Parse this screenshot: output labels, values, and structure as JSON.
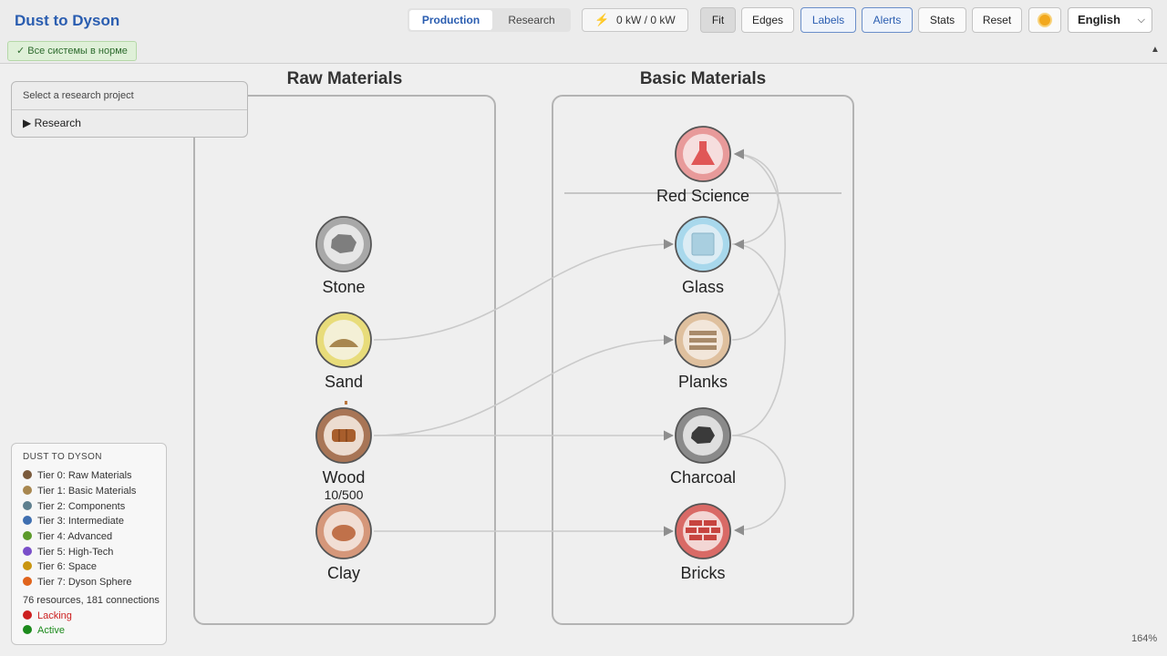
{
  "app": {
    "title": "Dust to Dyson",
    "status": "✓ Все системы в норме"
  },
  "tabs": [
    {
      "label": "Production",
      "active": true
    },
    {
      "label": "Research",
      "active": false
    }
  ],
  "power": {
    "icon": "lightning-icon",
    "value": "0 kW / 0 kW"
  },
  "toolbar": {
    "fit": "Fit",
    "edges": "Edges",
    "labels": "Labels",
    "alerts": "Alerts",
    "stats": "Stats",
    "reset": "Reset",
    "theme_icon": "sun-icon",
    "language": "English"
  },
  "groups": {
    "raw": {
      "title": "Raw Materials"
    },
    "basic": {
      "title": "Basic Materials"
    }
  },
  "nodes": {
    "stone": {
      "label": "Stone",
      "color": "#a8a8a8"
    },
    "sand": {
      "label": "Sand",
      "color": "#e8dc7a"
    },
    "wood": {
      "label": "Wood",
      "stock": "10/500",
      "color": "#a87556"
    },
    "clay": {
      "label": "Clay",
      "color": "#d5977a"
    },
    "red_science": {
      "label": "Red Science",
      "color": "#e89a9a"
    },
    "glass": {
      "label": "Glass",
      "color": "#a8d8ec"
    },
    "planks": {
      "label": "Planks",
      "color": "#dfc09e"
    },
    "charcoal": {
      "label": "Charcoal",
      "color": "#8a8a8a"
    },
    "bricks": {
      "label": "Bricks",
      "color": "#d96a66"
    }
  },
  "research_panel": {
    "placeholder": "Select a research project",
    "toggle": "▶ Research"
  },
  "legend": {
    "title": "DUST TO DYSON",
    "tiers": [
      {
        "label": "Tier 0: Raw Materials",
        "color": "#7a5a3c"
      },
      {
        "label": "Tier 1: Basic Materials",
        "color": "#a8874f"
      },
      {
        "label": "Tier 2: Components",
        "color": "#5e7f8e"
      },
      {
        "label": "Tier 3: Intermediate",
        "color": "#3f6fb0"
      },
      {
        "label": "Tier 4: Advanced",
        "color": "#5c9a2a"
      },
      {
        "label": "Tier 5: High-Tech",
        "color": "#7a4fc9"
      },
      {
        "label": "Tier 6: Space",
        "color": "#c9950f"
      },
      {
        "label": "Tier 7: Dyson Sphere",
        "color": "#e0641c"
      }
    ],
    "summary": "76 resources, 181 connections",
    "status": [
      {
        "label": "Lacking",
        "color": "#cc1f1f"
      },
      {
        "label": "Active",
        "color": "#1c8a1c"
      }
    ]
  },
  "zoom": "164%"
}
